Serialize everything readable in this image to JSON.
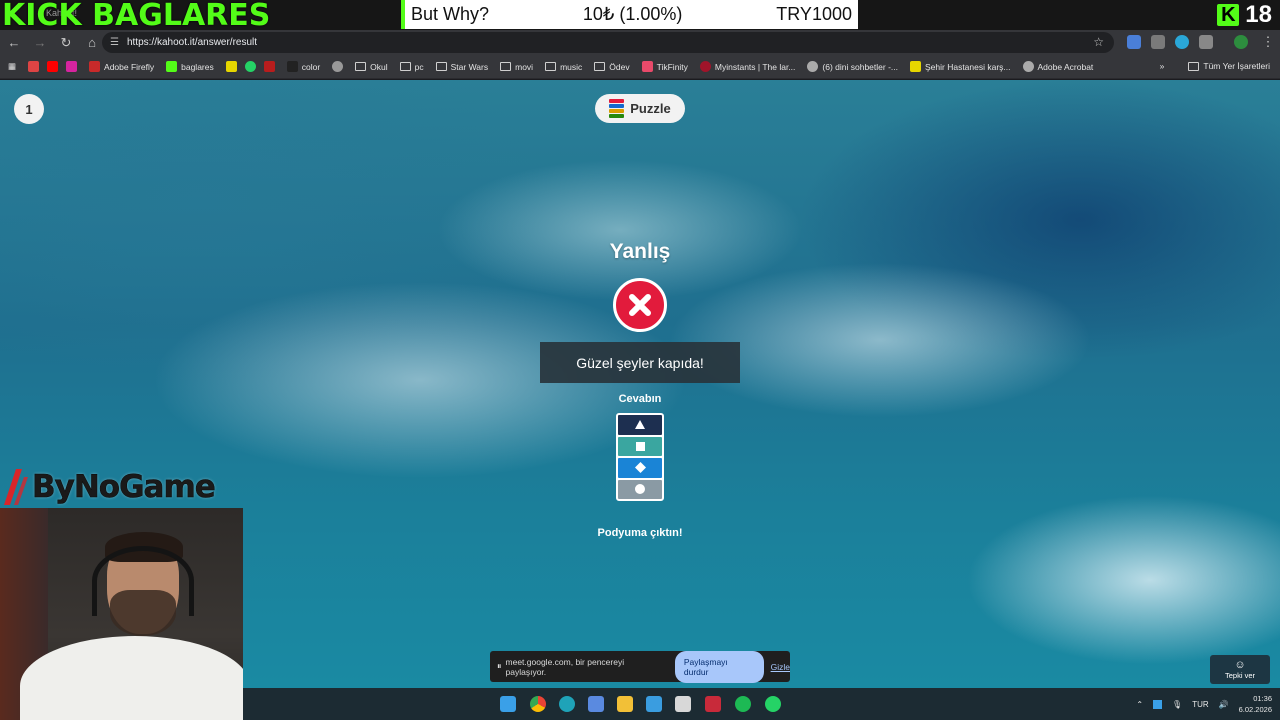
{
  "overlay": {
    "kick_title": "KICK BAGLARES",
    "tab_ghost": "Kahoot!",
    "ticker": {
      "label": "But Why?",
      "amount": "10₺ (1.00%)",
      "goal": "TRY1000"
    },
    "kick_count": "18"
  },
  "browser": {
    "url": "https://kahoot.it/answer/result",
    "bookmarks": [
      "Adobe Firefly",
      "baglares",
      "color",
      "Okul",
      "pc",
      "Star Wars",
      "movi",
      "music",
      "Ödev",
      "TikFinity",
      "Myinstants | The lar...",
      "(6) dini sohbetler -...",
      "Şehir Hastanesi karş...",
      "Adobe Acrobat"
    ],
    "bookmarks_all": "Tüm Yer İşaretleri"
  },
  "kahoot": {
    "question_counter": "1",
    "quiz_type": "Puzzle",
    "result_title": "Yanlış",
    "message": "Güzel şeyler kapıda!",
    "answer_label": "Cevabın",
    "podium_text": "Podyuma çıktın!",
    "answer_colors": [
      "#1d2f50",
      "#3aa6a0",
      "#1a84d6",
      "#8a9aa4"
    ],
    "answer_icons": [
      "triangle-icon",
      "square-icon",
      "diamond-icon",
      "circle-icon"
    ]
  },
  "share_bar": {
    "text": "meet.google.com, bir pencereyi paylaşıyor.",
    "stop_label": "Paylaşmayı durdur",
    "hide_label": "Gizle"
  },
  "react_label": "Tepki ver",
  "taskbar": {
    "language": "TUR",
    "time": "01:36",
    "date": "6.02.2026"
  },
  "streamer": {
    "sponsor": "ByNoGame"
  }
}
